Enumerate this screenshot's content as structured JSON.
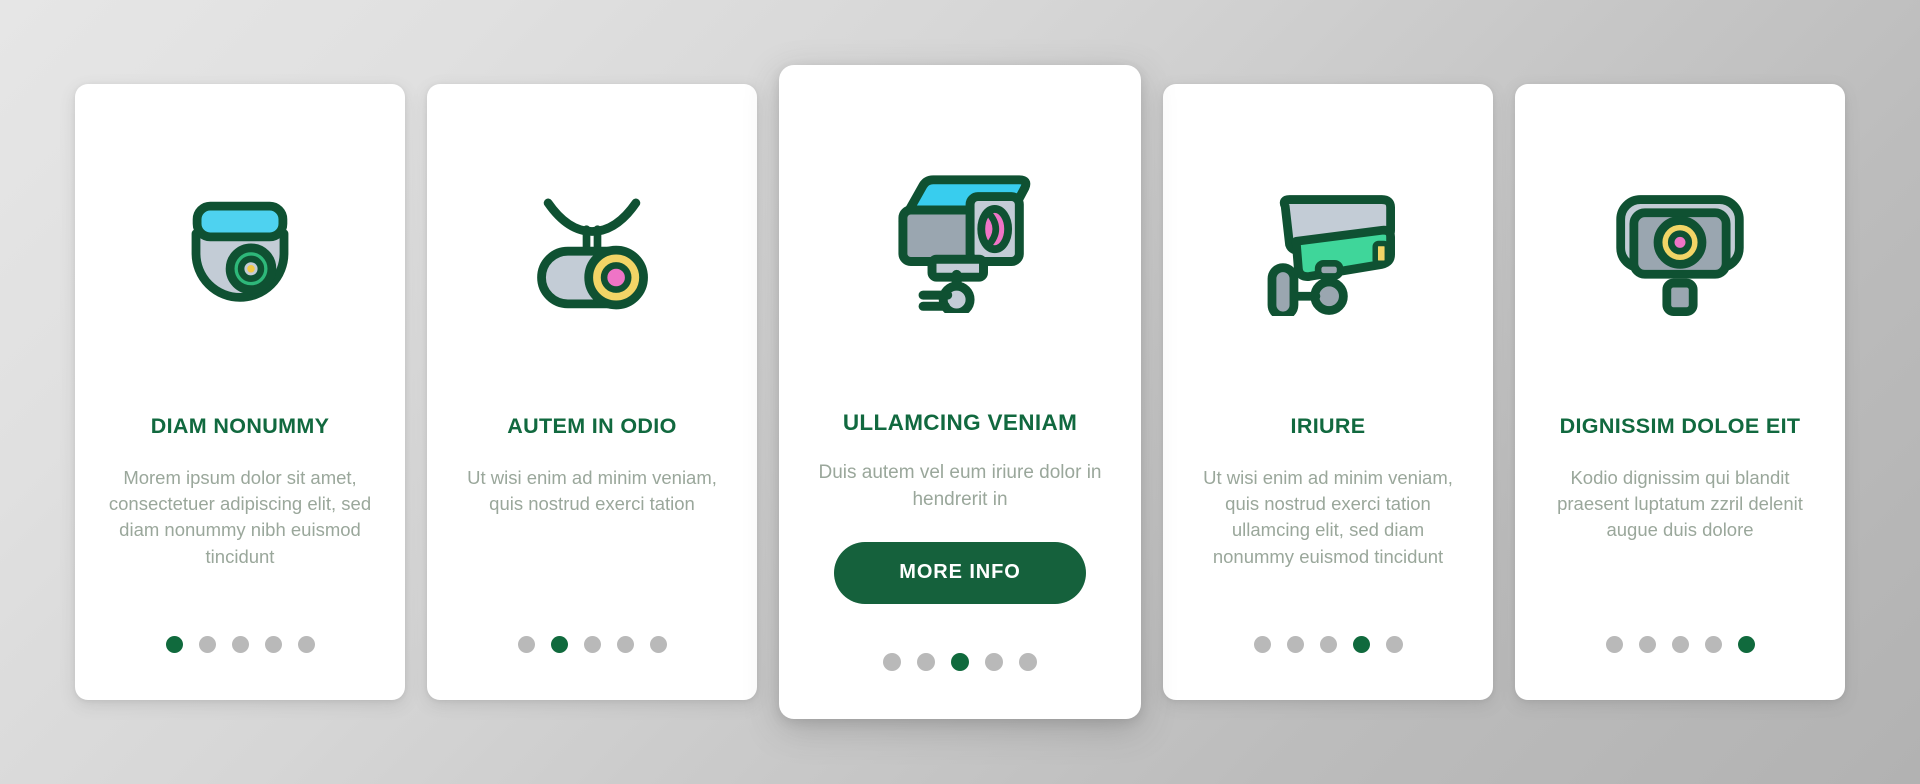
{
  "theme": {
    "brand_green": "#11693f",
    "button_green": "#15613c",
    "body_text_gray": "#9aa79b",
    "dot_inactive": "#b9b9b9",
    "dot_active": "#106a3d",
    "card_bg": "#ffffff",
    "accent_cyan": "#4ed2f0",
    "accent_yellow": "#f2d566",
    "accent_pink": "#ef74c6",
    "accent_teal": "#3fd69a",
    "body_gray_fill": "#b9c3cc",
    "outline_green": "#0f5132"
  },
  "cards": [
    {
      "icon": "dome-camera-icon",
      "title": "DIAM NONUMMY",
      "body": "Morem ipsum dolor sit amet, consectetuer adipiscing elit, sed diam nonummy nibh euismod tincidunt",
      "dots": 5,
      "active_dot": 0,
      "featured": false,
      "cta": null
    },
    {
      "icon": "ceiling-mount-camera-icon",
      "title": "AUTEM IN ODIO",
      "body": "Ut wisi enim ad minim veniam, quis nostrud exerci tation",
      "dots": 5,
      "active_dot": 1,
      "featured": false,
      "cta": null
    },
    {
      "icon": "cctv-camera-icon",
      "title": "ULLAMCING VENIAM",
      "body": "Duis autem vel eum iriure dolor in hendrerit in",
      "dots": 5,
      "active_dot": 2,
      "featured": true,
      "cta": "MORE INFO"
    },
    {
      "icon": "wall-mount-camera-icon",
      "title": "IRIURE",
      "body": "Ut wisi enim ad minim veniam, quis nostrud exerci tation ullamcing elit, sed diam nonummy euismod tincidunt",
      "dots": 5,
      "active_dot": 3,
      "featured": false,
      "cta": null
    },
    {
      "icon": "front-camera-icon",
      "title": "DIGNISSIM DOLOE EIT",
      "body": "Kodio dignissim qui blandit praesent luptatum zzril delenit augue duis dolore",
      "dots": 5,
      "active_dot": 4,
      "featured": false,
      "cta": null
    }
  ]
}
